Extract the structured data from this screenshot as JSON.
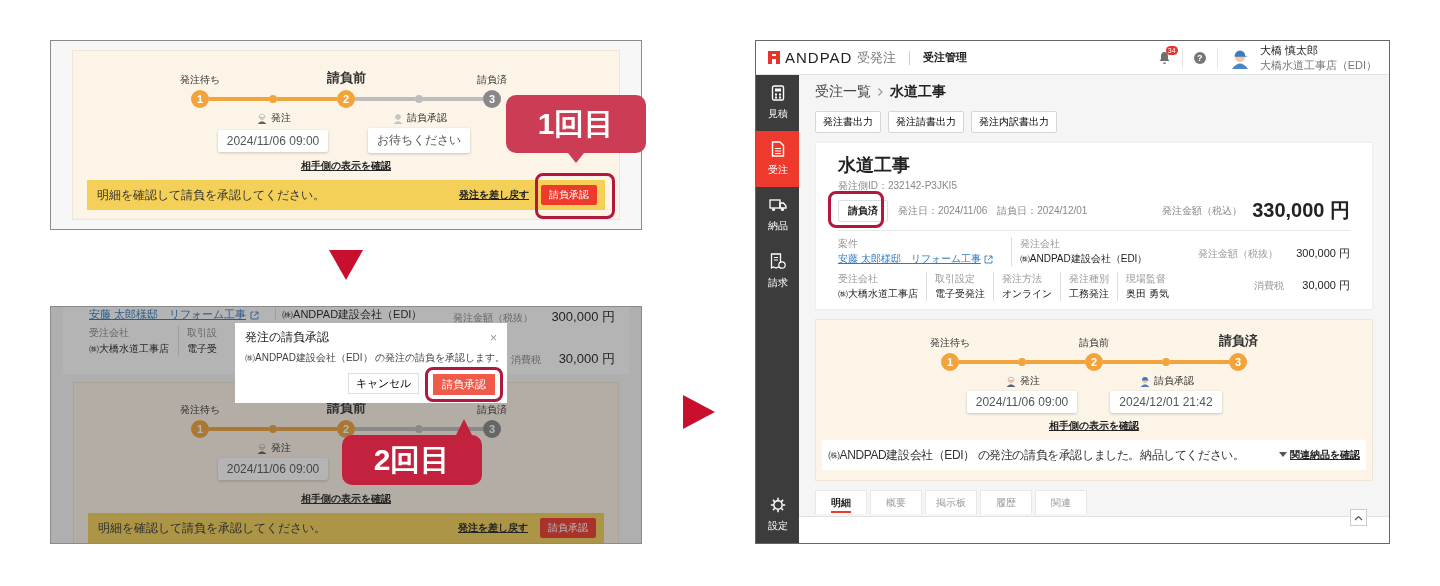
{
  "before_approval": {
    "tracker": {
      "stages": [
        {
          "number": "1",
          "label": "発注待ち",
          "current": false,
          "done": true
        },
        {
          "number": "2",
          "label": "請負前",
          "current": true,
          "done": true
        },
        {
          "number": "3",
          "label": "請負済",
          "current": false,
          "done": false
        }
      ],
      "events": [
        {
          "label": "発注",
          "detail": "2024/11/06 09:00",
          "done": true,
          "kind": "helmet"
        },
        {
          "label": "請負承認",
          "detail": "お待ちください",
          "done": false,
          "kind": "blank"
        }
      ]
    },
    "partner_link": "相手側の表示を確認",
    "notice": {
      "message": "明細を確認して請負を承認してください。",
      "link": "発注を差し戻す",
      "button": "請負承認"
    },
    "callout": "1回目"
  },
  "confirm_dialog": {
    "summary": {
      "project_link": "安藤 太郎様邸　リフォーム工事",
      "orderer": "㈱ANDPAD建設会社（EDI）",
      "fields": [
        {
          "label": "受注会社",
          "value": "㈱大橋水道工事店"
        },
        {
          "label": "取引設",
          "value": "電子受"
        }
      ],
      "amounts": [
        {
          "label": "発注金額（税抜）",
          "value": "300,000 円"
        },
        {
          "label": "消費税",
          "value": "30,000 円"
        }
      ]
    },
    "tracker": {
      "stages": [
        {
          "number": "1",
          "label": "発注待ち",
          "current": false,
          "done": true
        },
        {
          "number": "2",
          "label": "請負前",
          "current": true,
          "done": true
        },
        {
          "number": "3",
          "label": "請負済",
          "current": false,
          "done": false
        }
      ],
      "events": [
        {
          "label": "発注",
          "detail": "2024/11/06 09:00",
          "done": true,
          "kind": "helmet"
        },
        {
          "done": false
        }
      ]
    },
    "partner_link": "相手側の表示を確認",
    "notice": {
      "message": "明細を確認して請負を承認してください。",
      "link": "発注を差し戻す",
      "button": "請負承認"
    },
    "dialog": {
      "title": "発注の請負承認",
      "close": "×",
      "message": "㈱ANDPAD建設会社（EDI） の発注の請負を承認します。",
      "buttons": [
        {
          "label": "キャンセル",
          "kind": "secondary"
        },
        {
          "label": "請負承認",
          "kind": "primary"
        }
      ]
    },
    "callout": "2回目"
  },
  "after_approval": {
    "header": {
      "brand": "ANDPAD",
      "product": "受発注",
      "section": "受注管理",
      "notifications": "34",
      "help": "?",
      "user_name": "大橋 慎太郎",
      "user_company": "大橋水道工事店（EDI）"
    },
    "sidebar": {
      "items": [
        {
          "label": "見積",
          "selected": false
        },
        {
          "label": "受注",
          "selected": true
        },
        {
          "label": "納品",
          "selected": false
        },
        {
          "label": "請求",
          "selected": false
        }
      ],
      "settings": "設定"
    },
    "breadcrumb": [
      "受注一覧",
      "水道工事"
    ],
    "actions": [
      "発注書出力",
      "発注請書出力",
      "発注内訳書出力"
    ],
    "order": {
      "title": "水道工事",
      "order_id": "発注側ID：232142-P3JKI5",
      "status": "請負済",
      "order_date": "発注日：2024/11/06",
      "contract_date": "請負日：2024/12/01",
      "total_label": "発注金額（税込）",
      "total": "330,000 円",
      "top_fields": [
        {
          "label": "案件",
          "value": "安藤 太郎様邸　リフォーム工事",
          "kind": "link"
        },
        {
          "label": "発注会社",
          "value": "㈱ANDPAD建設会社（EDI）",
          "kind": "text"
        }
      ],
      "fields": [
        {
          "label": "受注会社",
          "value": "㈱大橋水道工事店"
        },
        {
          "label": "取引設定",
          "value": "電子受発注"
        },
        {
          "label": "発注方法",
          "value": "オンライン"
        },
        {
          "label": "発注種別",
          "value": "工務発注"
        },
        {
          "label": "現場監督",
          "value": "奥田 勇気"
        }
      ],
      "amounts": [
        {
          "label": "発注金額（税抜）",
          "value": "300,000 円"
        },
        {
          "label": "消費税",
          "value": "30,000 円"
        }
      ]
    },
    "tracker": {
      "stages": [
        {
          "number": "1",
          "label": "発注待ち",
          "current": false,
          "done": true
        },
        {
          "number": "2",
          "label": "請負前",
          "current": false,
          "done": true
        },
        {
          "number": "3",
          "label": "請負済",
          "current": true,
          "done": true
        }
      ],
      "events": [
        {
          "label": "発注",
          "detail": "2024/11/06 09:00",
          "done": true,
          "kind": "helmet"
        },
        {
          "label": "請負承認",
          "detail": "2024/12/01 21:42",
          "done": true,
          "kind": "cap"
        }
      ]
    },
    "partner_link": "相手側の表示を確認",
    "message": "㈱ANDPAD建設会社（EDI） の発注の請負を承認しました。納品してください。",
    "related_link": "関連納品を確認",
    "tabs": [
      {
        "label": "明細",
        "selected": true
      },
      {
        "label": "概要",
        "selected": false
      },
      {
        "label": "掲示板",
        "selected": false
      },
      {
        "label": "履歴",
        "selected": false
      },
      {
        "label": "関連",
        "selected": false
      }
    ]
  }
}
